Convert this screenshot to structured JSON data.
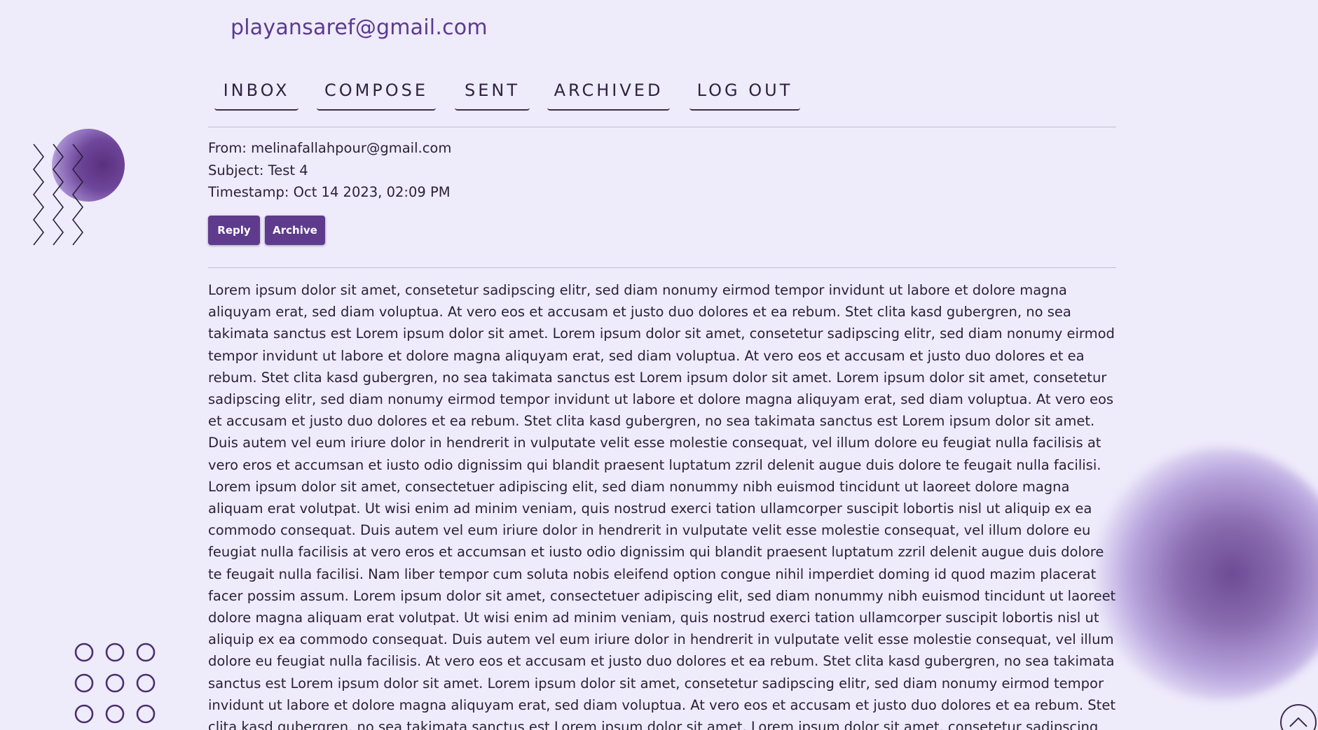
{
  "account": {
    "email": "playansaref@gmail.com"
  },
  "nav": {
    "items": [
      {
        "label": "INBOX"
      },
      {
        "label": "COMPOSE"
      },
      {
        "label": "SENT"
      },
      {
        "label": "ARCHIVED"
      },
      {
        "label": "LOG OUT"
      }
    ]
  },
  "message": {
    "from_line": "From: melinafallahpour@gmail.com",
    "subject_line": "Subject: Test 4",
    "timestamp_line": "Timestamp: Oct 14 2023, 02:09 PM",
    "body": "Lorem ipsum dolor sit amet, consetetur sadipscing elitr, sed diam nonumy eirmod tempor invidunt ut labore et dolore magna aliquyam erat, sed diam voluptua. At vero eos et accusam et justo duo dolores et ea rebum. Stet clita kasd gubergren, no sea takimata sanctus est Lorem ipsum dolor sit amet. Lorem ipsum dolor sit amet, consetetur sadipscing elitr, sed diam nonumy eirmod tempor invidunt ut labore et dolore magna aliquyam erat, sed diam voluptua. At vero eos et accusam et justo duo dolores et ea rebum. Stet clita kasd gubergren, no sea takimata sanctus est Lorem ipsum dolor sit amet. Lorem ipsum dolor sit amet, consetetur sadipscing elitr, sed diam nonumy eirmod tempor invidunt ut labore et dolore magna aliquyam erat, sed diam voluptua. At vero eos et accusam et justo duo dolores et ea rebum. Stet clita kasd gubergren, no sea takimata sanctus est Lorem ipsum dolor sit amet. Duis autem vel eum iriure dolor in hendrerit in vulputate velit esse molestie consequat, vel illum dolore eu feugiat nulla facilisis at vero eros et accumsan et iusto odio dignissim qui blandit praesent luptatum zzril delenit augue duis dolore te feugait nulla facilisi. Lorem ipsum dolor sit amet, consectetuer adipiscing elit, sed diam nonummy nibh euismod tincidunt ut laoreet dolore magna aliquam erat volutpat. Ut wisi enim ad minim veniam, quis nostrud exerci tation ullamcorper suscipit lobortis nisl ut aliquip ex ea commodo consequat. Duis autem vel eum iriure dolor in hendrerit in vulputate velit esse molestie consequat, vel illum dolore eu feugiat nulla facilisis at vero eros et accumsan et iusto odio dignissim qui blandit praesent luptatum zzril delenit augue duis dolore te feugait nulla facilisi. Nam liber tempor cum soluta nobis eleifend option congue nihil imperdiet doming id quod mazim placerat facer possim assum. Lorem ipsum dolor sit amet, consectetuer adipiscing elit, sed diam nonummy nibh euismod tincidunt ut laoreet dolore magna aliquam erat volutpat. Ut wisi enim ad minim veniam, quis nostrud exerci tation ullamcorper suscipit lobortis nisl ut aliquip ex ea commodo consequat. Duis autem vel eum iriure dolor in hendrerit in vulputate velit esse molestie consequat, vel illum dolore eu feugiat nulla facilisis. At vero eos et accusam et justo duo dolores et ea rebum. Stet clita kasd gubergren, no sea takimata sanctus est Lorem ipsum dolor sit amet. Lorem ipsum dolor sit amet, consetetur sadipscing elitr, sed diam nonumy eirmod tempor invidunt ut labore et dolore magna aliquyam erat, sed diam voluptua. At vero eos et accusam et justo duo dolores et ea rebum. Stet clita kasd gubergren, no sea takimata sanctus est Lorem ipsum dolor sit amet. Lorem ipsum dolor sit amet, consetetur sadipscing elitr, At accusam aliquyam diam diam dolore dolores duo eirmod eos erat, et nonumy sed tempor et et invidunt justo labore Stet clita ea et"
  },
  "actions": {
    "reply_label": "Reply",
    "archive_label": "Archive"
  },
  "icons": {
    "scroll_top": "chevron-up-icon"
  },
  "colors": {
    "background": "#eeebfb",
    "accent": "#5e3b8c",
    "email_text": "#5c3a8f"
  }
}
